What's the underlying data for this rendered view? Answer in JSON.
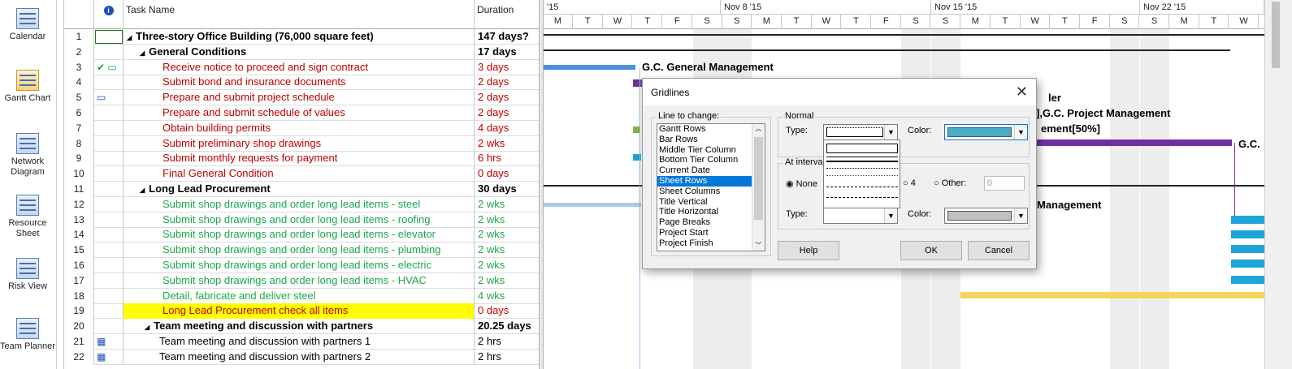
{
  "sidebar": [
    {
      "label": "Calendar",
      "icon": "calendar-icon"
    },
    {
      "label": "Gantt Chart",
      "icon": "gantt-chart-icon"
    },
    {
      "label": "Network Diagram",
      "icon": "network-diagram-icon"
    },
    {
      "label": "Resource Sheet",
      "icon": "resource-sheet-icon"
    },
    {
      "label": "Risk View",
      "icon": "risk-view-icon"
    },
    {
      "label": "Team Planner",
      "icon": "team-planner-icon"
    }
  ],
  "grid": {
    "headers": {
      "indicators": "i",
      "name": "Task Name",
      "duration": "Duration"
    },
    "rows": [
      {
        "id": "1",
        "name": "Three-story Office Building (76,000 square feet)",
        "duration": "147 days?",
        "level": "lvl0",
        "color": "black",
        "collapse": "◢"
      },
      {
        "id": "2",
        "name": "General Conditions",
        "duration": "17 days",
        "level": "lvl1",
        "color": "black",
        "collapse": "◢"
      },
      {
        "id": "3",
        "name": "Receive notice to proceed and sign contract",
        "duration": "3 days",
        "level": "lvl2",
        "color": "red",
        "ind": "✔ ▭"
      },
      {
        "id": "4",
        "name": "Submit bond and insurance documents",
        "duration": "2 days",
        "level": "lvl2",
        "color": "red"
      },
      {
        "id": "5",
        "name": "Prepare and submit project schedule",
        "duration": "2 days",
        "level": "lvl2",
        "color": "red",
        "ind": "▭"
      },
      {
        "id": "6",
        "name": "Prepare and submit schedule of values",
        "duration": "2 days",
        "level": "lvl2",
        "color": "red"
      },
      {
        "id": "7",
        "name": "Obtain building permits",
        "duration": "4 days",
        "level": "lvl2",
        "color": "red"
      },
      {
        "id": "8",
        "name": "Submit preliminary shop drawings",
        "duration": "2 wks",
        "level": "lvl2",
        "color": "red"
      },
      {
        "id": "9",
        "name": "Submit monthly requests for payment",
        "duration": "6 hrs",
        "level": "lvl2",
        "color": "red"
      },
      {
        "id": "10",
        "name": "Final General Condition",
        "duration": "0 days",
        "level": "lvl2",
        "color": "red"
      },
      {
        "id": "11",
        "name": "Long Lead Procurement",
        "duration": "30 days",
        "level": "lvl1",
        "color": "black",
        "collapse": "◢"
      },
      {
        "id": "12",
        "name": "Submit shop drawings and order long lead items - steel",
        "duration": "2 wks",
        "level": "lvl2",
        "color": "green"
      },
      {
        "id": "13",
        "name": "Submit shop drawings and order long lead items - roofing",
        "duration": "2 wks",
        "level": "lvl2",
        "color": "green"
      },
      {
        "id": "14",
        "name": "Submit shop drawings and order long lead items - elevator",
        "duration": "2 wks",
        "level": "lvl2",
        "color": "green"
      },
      {
        "id": "15",
        "name": "Submit shop drawings and order long lead items - plumbing",
        "duration": "2 wks",
        "level": "lvl2",
        "color": "green"
      },
      {
        "id": "16",
        "name": "Submit shop drawings and order long lead items - electric",
        "duration": "2 wks",
        "level": "lvl2",
        "color": "green"
      },
      {
        "id": "17",
        "name": "Submit shop drawings and order long lead items - HVAC",
        "duration": "2 wks",
        "level": "lvl2",
        "color": "green"
      },
      {
        "id": "18",
        "name": "Detail, fabricate and deliver steel",
        "duration": "4 wks",
        "level": "lvl2",
        "color": "green"
      },
      {
        "id": "19",
        "name": "Long Lead Procurement check all items",
        "duration": "0 days",
        "level": "lvl2",
        "color": "red",
        "highlight": true
      },
      {
        "id": "20",
        "name": "Team meeting and discussion with partners",
        "duration": "20.25 days",
        "level": "lvl0",
        "color": "black",
        "collapse": "◢",
        "indent": true
      },
      {
        "id": "21",
        "name": "Team meeting and discussion with partners 1",
        "duration": "2 hrs",
        "level": "lvl2s",
        "color": "black",
        "ind": "▦"
      },
      {
        "id": "22",
        "name": "Team meeting and discussion with partners 2",
        "duration": "2 hrs",
        "level": "lvl2s",
        "color": "black",
        "ind": "▦"
      }
    ]
  },
  "timescale": {
    "weeks": [
      "'15",
      "Nov 8 '15",
      "Nov 15 '15",
      "Nov 22 '15"
    ],
    "days": [
      "M",
      "T",
      "W",
      "T",
      "F",
      "S",
      "S",
      "M",
      "T",
      "W",
      "T",
      "F",
      "S",
      "S",
      "M",
      "T",
      "W",
      "T",
      "F",
      "S",
      "S",
      "M",
      "T",
      "W",
      "T"
    ]
  },
  "bar_labels": [
    "G.C. General Management",
    "ler",
    "],G.C. Project Management",
    "ement[50%]",
    "G.C.",
    "Management"
  ],
  "dialog": {
    "title": "Gridlines",
    "line_to_change_label": "Line to change:",
    "line_items": [
      "Gantt Rows",
      "Bar Rows",
      "Middle Tier Column",
      "Bottom Tier Column",
      "Current Date",
      "Sheet Rows",
      "Sheet Columns",
      "Title Vertical",
      "Title Horizontal",
      "Page Breaks",
      "Project Start",
      "Project Finish"
    ],
    "selected_item": "Sheet Rows",
    "normal_label": "Normal",
    "type_label": "Type:",
    "color_label": "Color:",
    "interval_label": "At interva",
    "none_label": "None",
    "opt4_label": "4",
    "other_label": "Other:",
    "other_value": "0",
    "type2_label": "Type:",
    "color2_label": "Color:",
    "help_label": "Help",
    "ok_label": "OK",
    "cancel_label": "Cancel",
    "normal_color": "#4bacc6",
    "interval_color": "#c0c0c0"
  }
}
